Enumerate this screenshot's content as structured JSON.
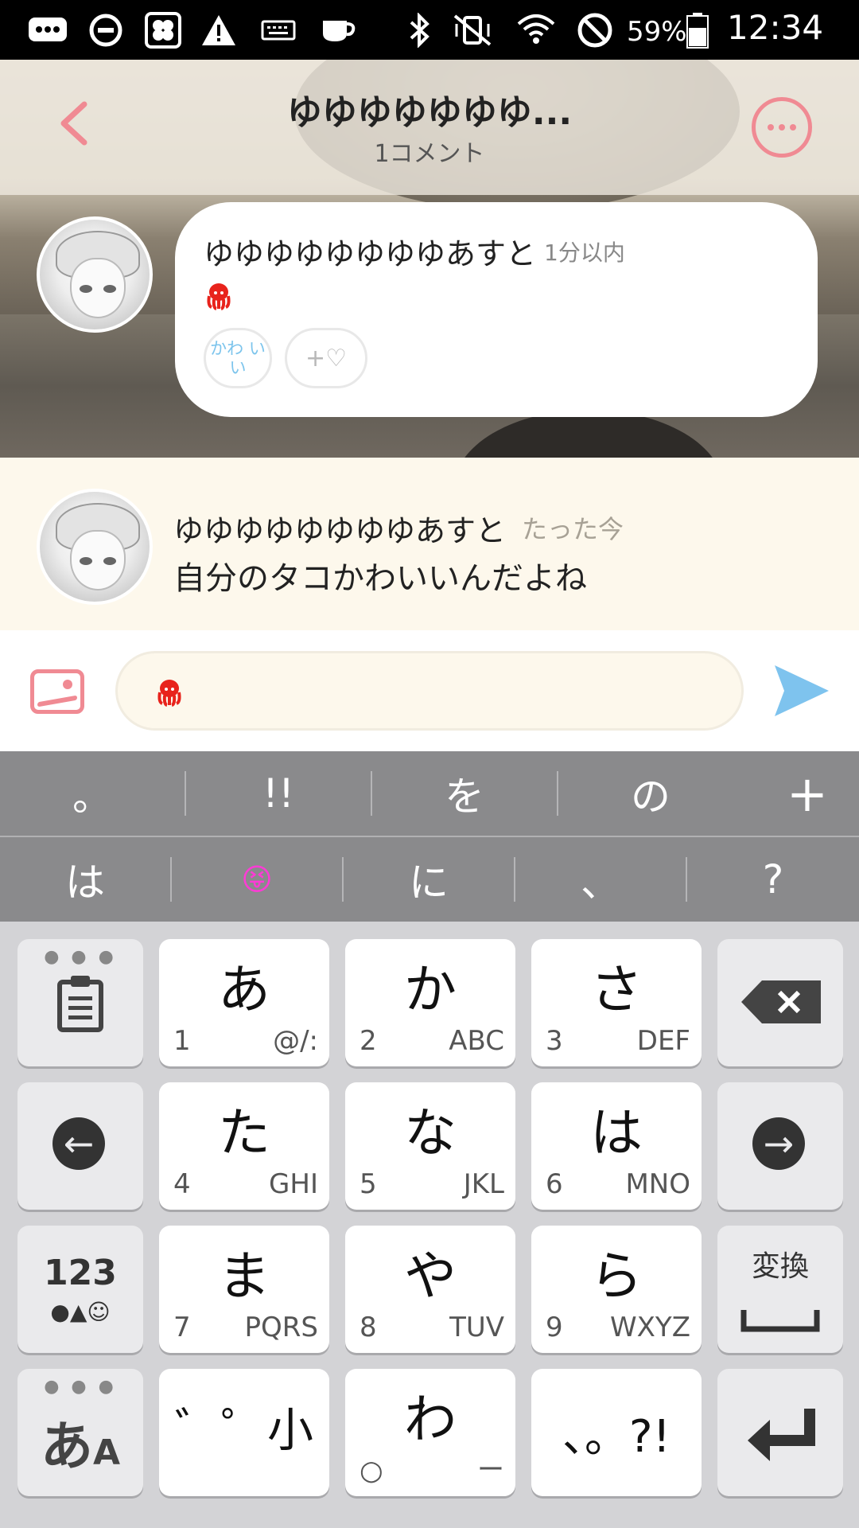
{
  "status_bar": {
    "battery_percent": "59%",
    "time": "12:34"
  },
  "header": {
    "title": "ゆゆゆゆゆゆゆ...",
    "subtitle": "1コメント"
  },
  "post": {
    "author": "ゆゆゆゆゆゆゆゆあすと",
    "time": "1分以内",
    "reaction_kawaii": "かわ いい",
    "reaction_like": "+♡"
  },
  "comment": {
    "author": "ゆゆゆゆゆゆゆゆあすと",
    "time": "たった今",
    "text": "自分のタコかわいいんだよね"
  },
  "composer": {
    "value_icon": "octopus-emoji"
  },
  "keyboard": {
    "suggestions_row1": [
      "。",
      "!!",
      "を",
      "の",
      "+"
    ],
    "suggestions_row2": [
      "は",
      "😝",
      "に",
      "、",
      "?"
    ],
    "keys": {
      "a": {
        "main": "あ",
        "num": "1",
        "alpha": "@/:"
      },
      "ka": {
        "main": "か",
        "num": "2",
        "alpha": "ABC"
      },
      "sa": {
        "main": "さ",
        "num": "3",
        "alpha": "DEF"
      },
      "ta": {
        "main": "た",
        "num": "4",
        "alpha": "GHI"
      },
      "na": {
        "main": "な",
        "num": "5",
        "alpha": "JKL"
      },
      "ha": {
        "main": "は",
        "num": "6",
        "alpha": "MNO"
      },
      "ma": {
        "main": "ま",
        "num": "7",
        "alpha": "PQRS"
      },
      "ya": {
        "main": "や",
        "num": "8",
        "alpha": "TUV"
      },
      "ra": {
        "main": "ら",
        "num": "9",
        "alpha": "WXYZ"
      },
      "dakuten": {
        "main": "゛゜小"
      },
      "wa": {
        "main": "わ",
        "num": "○",
        "alpha": "ー"
      },
      "punct": {
        "main": "、。?!"
      },
      "mode123": {
        "top": "123",
        "bottom": "●▲☺"
      },
      "kana": {
        "main": "あ",
        "sub": "A"
      },
      "henkan": {
        "main": "変換"
      }
    }
  }
}
